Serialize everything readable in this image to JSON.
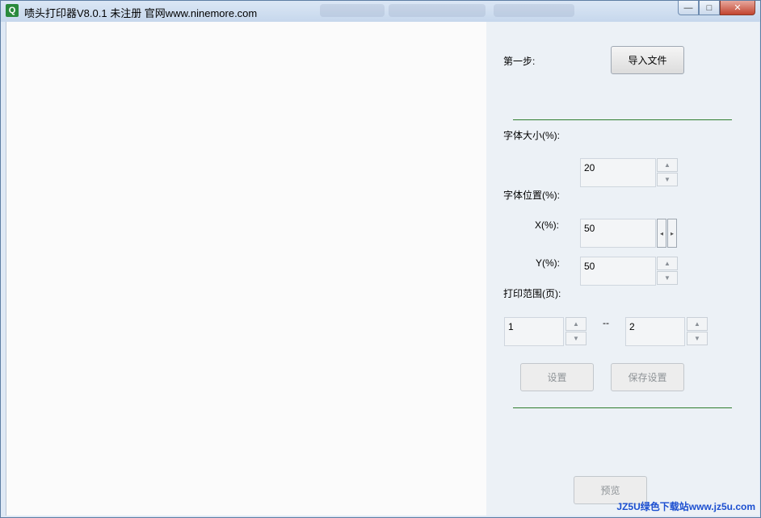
{
  "window": {
    "title": "啧头打印器V8.0.1 未注册  官网www.ninemore.com",
    "icon_letter": "Q",
    "minimize": "—",
    "maximize": "□",
    "close": "✕"
  },
  "panel": {
    "step1_label": "第一步:",
    "import_button": "导入文件",
    "font_size_label": "字体大小(%):",
    "font_size_value": "20",
    "font_position_label": "字体位置(%):",
    "x_label": "X(%):",
    "x_value": "50",
    "y_label": "Y(%):",
    "y_value": "50",
    "print_range_label": "打印范围(页):",
    "range_from": "1",
    "range_separator": "--",
    "range_to": "2",
    "settings_button": "设置",
    "save_settings_button": "保存设置",
    "preview_button": "预览"
  },
  "watermark": "JZ5U绿色下载站www.jz5u.com",
  "colors": {
    "separator": "#2e7d2e",
    "watermark": "#1c4fd0",
    "panel_bg": "#ecf1f6"
  },
  "icons": {
    "spin_up": "▲",
    "spin_down": "▼",
    "spin_left": "◂",
    "spin_right": "▸"
  }
}
